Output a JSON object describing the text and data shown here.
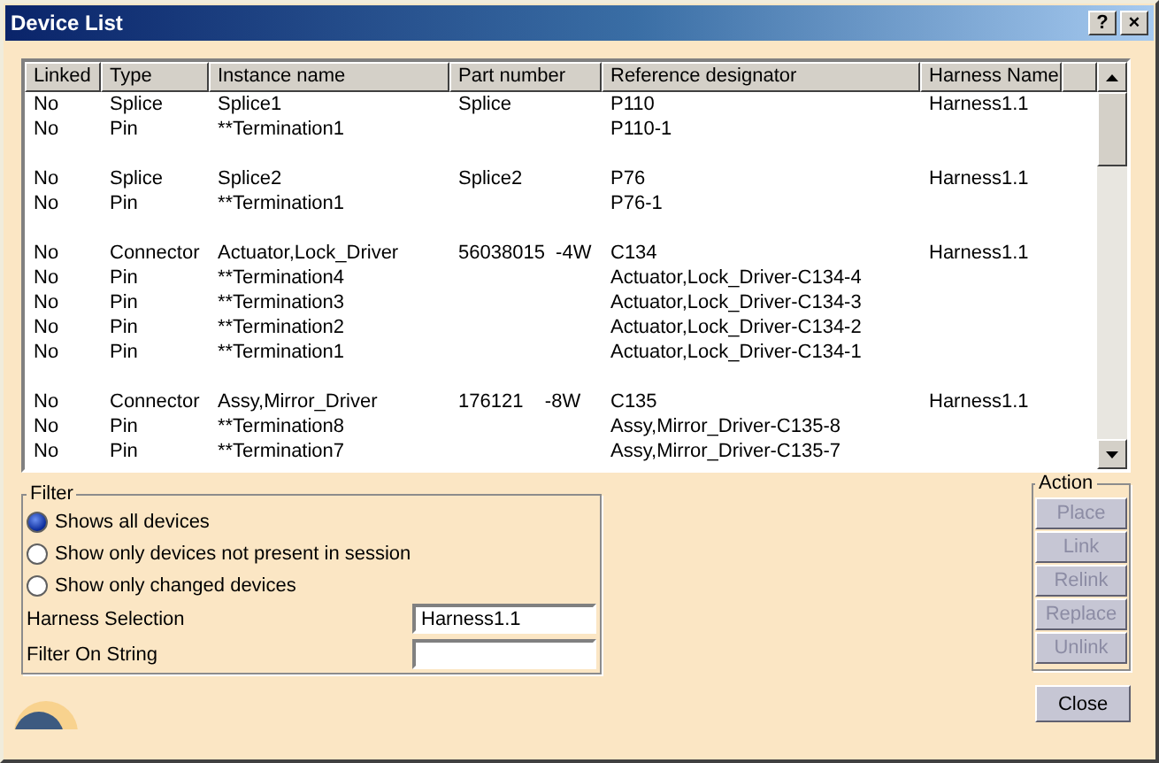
{
  "window": {
    "title": "Device List",
    "help_button": "?",
    "close_button": "×"
  },
  "table": {
    "columns": [
      "Linked",
      "Type",
      "Instance name",
      "Part number",
      "Reference designator",
      "Harness Name"
    ],
    "groups": [
      {
        "rows": [
          [
            "No",
            "Splice",
            "Splice1",
            "Splice",
            "P110",
            "Harness1.1"
          ],
          [
            "No",
            "Pin",
            "**Termination1",
            "",
            "P110-1",
            ""
          ]
        ]
      },
      {
        "rows": [
          [
            "No",
            "Splice",
            "Splice2",
            "Splice2",
            "P76",
            "Harness1.1"
          ],
          [
            "No",
            "Pin",
            "**Termination1",
            "",
            "P76-1",
            ""
          ]
        ]
      },
      {
        "rows": [
          [
            "No",
            "Connector",
            "Actuator,Lock_Driver",
            "56038015  -4W",
            "C134",
            "Harness1.1"
          ],
          [
            "No",
            "Pin",
            "**Termination4",
            "",
            "Actuator,Lock_Driver-C134-4",
            ""
          ],
          [
            "No",
            "Pin",
            "**Termination3",
            "",
            "Actuator,Lock_Driver-C134-3",
            ""
          ],
          [
            "No",
            "Pin",
            "**Termination2",
            "",
            "Actuator,Lock_Driver-C134-2",
            ""
          ],
          [
            "No",
            "Pin",
            "**Termination1",
            "",
            "Actuator,Lock_Driver-C134-1",
            ""
          ]
        ]
      },
      {
        "rows": [
          [
            "No",
            "Connector",
            "Assy,Mirror_Driver",
            "176121    -8W",
            "C135",
            "Harness1.1"
          ],
          [
            "No",
            "Pin",
            "**Termination8",
            "",
            "Assy,Mirror_Driver-C135-8",
            ""
          ],
          [
            "No",
            "Pin",
            "**Termination7",
            "",
            "Assy,Mirror_Driver-C135-7",
            ""
          ]
        ]
      }
    ]
  },
  "filter": {
    "title": "Filter",
    "options": [
      {
        "label": "Shows all devices",
        "selected": true
      },
      {
        "label": "Show only devices not present in session",
        "selected": false
      },
      {
        "label": "Show only changed devices",
        "selected": false
      }
    ],
    "fields": [
      {
        "label": "Harness Selection",
        "value": "Harness1.1"
      },
      {
        "label": "Filter On String"
      }
    ]
  },
  "action": {
    "title": "Action",
    "buttons": [
      {
        "label": "Place",
        "disabled": true
      },
      {
        "label": "Link",
        "disabled": true
      },
      {
        "label": "Relink",
        "disabled": true
      },
      {
        "label": "Replace",
        "disabled": true
      },
      {
        "label": "Unlink",
        "disabled": true
      }
    ]
  },
  "close_button": "Close"
}
